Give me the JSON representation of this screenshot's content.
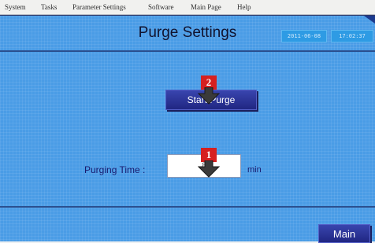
{
  "menu": {
    "items": [
      "System",
      "Tasks",
      "Parameter Settings",
      "Software",
      "Main Page",
      "Help"
    ]
  },
  "screen": {
    "title": "Purge Settings",
    "date": "2011-06-08",
    "time": "17:02:37"
  },
  "purge": {
    "start_label": "Start Purge",
    "time_label": "Purging Time :",
    "time_value": "8",
    "time_unit": "min"
  },
  "footer": {
    "main_label": "Main"
  },
  "markers": [
    "2",
    "1"
  ],
  "colors": {
    "panel": "#4a9ce6",
    "button": "#23288a",
    "marker": "#d62020",
    "title_text": "#10122e"
  }
}
